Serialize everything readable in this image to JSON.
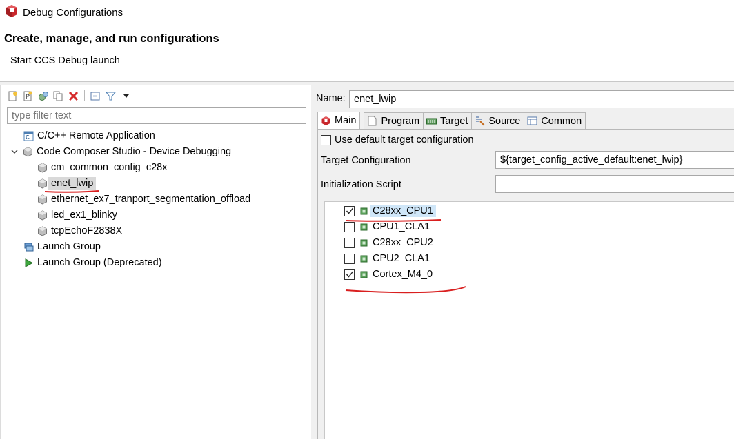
{
  "window": {
    "title": "Debug Configurations"
  },
  "banner": {
    "heading": "Create, manage, and run configurations",
    "description": "Start CCS Debug launch"
  },
  "left_panel": {
    "filter_placeholder": "type filter text",
    "tree": [
      {
        "label": "C/C++ Remote Application",
        "icon": "c-app-icon",
        "level": 0
      },
      {
        "label": "Code Composer Studio - Device Debugging",
        "icon": "ccs-cube-icon",
        "level": 0,
        "expanded": true
      },
      {
        "label": "cm_common_config_c28x",
        "icon": "ccs-cube-icon",
        "level": 1
      },
      {
        "label": "enet_lwip",
        "icon": "ccs-cube-icon",
        "level": 1,
        "selected": true
      },
      {
        "label": "ethernet_ex7_tranport_segmentation_offload",
        "icon": "ccs-cube-icon",
        "level": 1
      },
      {
        "label": "led_ex1_blinky",
        "icon": "ccs-cube-icon",
        "level": 1
      },
      {
        "label": "tcpEchoF2838X",
        "icon": "ccs-cube-icon",
        "level": 1
      },
      {
        "label": "Launch Group",
        "icon": "launch-group-icon",
        "level": 0
      },
      {
        "label": "Launch Group (Deprecated)",
        "icon": "play-icon",
        "level": 0
      }
    ]
  },
  "right_panel": {
    "name_label": "Name:",
    "name_value": "enet_lwip",
    "tabs": [
      {
        "label": "Main",
        "icon": "ccs-cube-icon",
        "active": true
      },
      {
        "label": "Program",
        "icon": "page-icon"
      },
      {
        "label": "Target",
        "icon": "target-icon"
      },
      {
        "label": "Source",
        "icon": "source-icon"
      },
      {
        "label": "Common",
        "icon": "common-icon"
      }
    ],
    "main": {
      "use_default_label": "Use default target configuration",
      "use_default_checked": false,
      "target_config_label": "Target Configuration",
      "target_config_value": "${target_config_active_default:enet_lwip}",
      "init_script_label": "Initialization Script",
      "init_script_value": "",
      "cores": [
        {
          "label": "C28xx_CPU1",
          "checked": true,
          "highlighted": true
        },
        {
          "label": "CPU1_CLA1",
          "checked": false
        },
        {
          "label": "C28xx_CPU2",
          "checked": false
        },
        {
          "label": "CPU2_CLA1",
          "checked": false
        },
        {
          "label": "Cortex_M4_0",
          "checked": true
        }
      ]
    }
  },
  "colors": {
    "annotation_red": "#d91f1f",
    "selection_blue": "#cfe6f8"
  }
}
